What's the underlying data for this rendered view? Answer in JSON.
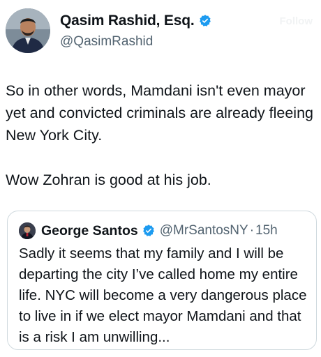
{
  "author": {
    "name": "Qasim Rashid, Esq.",
    "handle": "@QasimRashid",
    "verified_color": "#1d9bf0",
    "follow_label": "Follow"
  },
  "tweet": {
    "paragraph_1": "So in other words, Mamdani isn't even mayor yet and convicted criminals are already fleeing New York City.",
    "paragraph_2": "Wow Zohran is good at his job."
  },
  "quote": {
    "name": "George Santos",
    "handle": "@MrSantosNY",
    "separator": "·",
    "time": "15h",
    "text": "Sadly it seems that my family and I will be departing the city I’ve called home my entire life. NYC will become a very dangerous place to live in if we elect mayor Mamdani and that is a risk I am unwilling..."
  },
  "icons": {
    "author_avatar": "avatar-photo-icon",
    "author_badge": "verified-badge-icon",
    "quote_avatar": "avatar-photo-icon",
    "quote_badge": "verified-badge-icon"
  }
}
